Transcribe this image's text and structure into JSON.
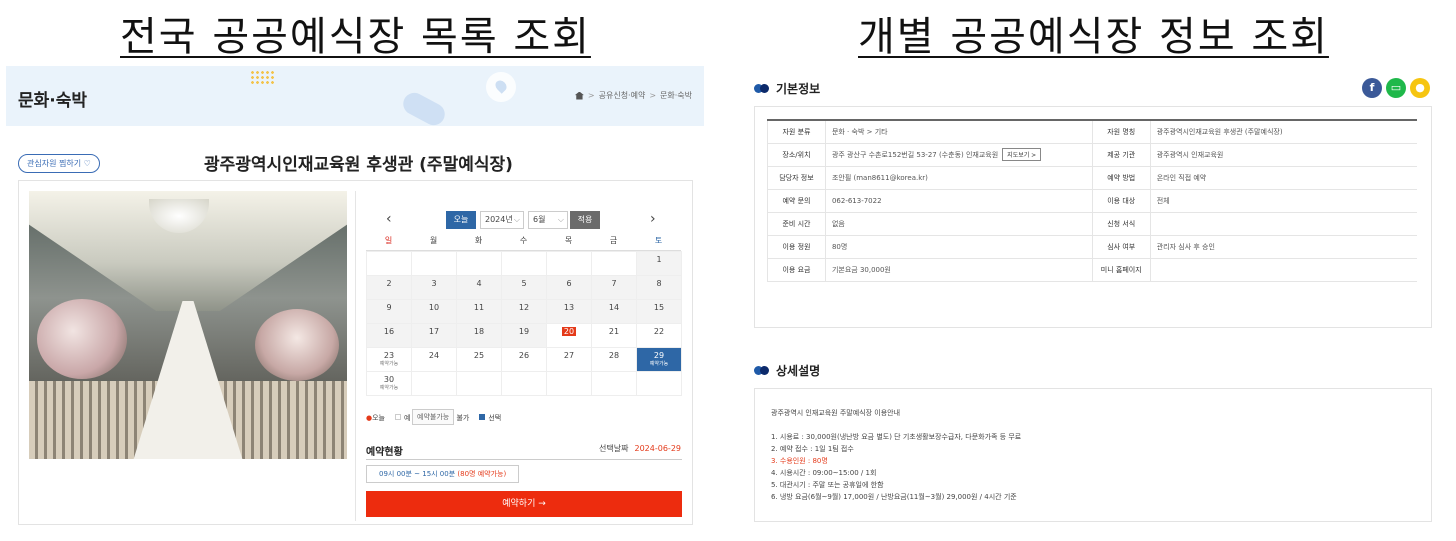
{
  "headings": {
    "left": "전국 공공예식장 목록 조회",
    "right": "개별 공공예식장 정보 조회"
  },
  "list": {
    "category": "문화·숙박",
    "breadcrumb": [
      "공유신청·예약",
      "문화·숙박"
    ],
    "fav_label": "관심자원 찜하기 ♡",
    "venue": "광주광역시인재교육원 후생관 (주말예식장)",
    "calendar": {
      "today_btn": "오늘",
      "year": "2024년",
      "month": "6월",
      "apply_btn": "적용",
      "prev": "‹",
      "next": "›",
      "dow": [
        "일",
        "월",
        "화",
        "수",
        "목",
        "금",
        "토"
      ],
      "dow_colors": [
        "#d9261c",
        "#444",
        "#444",
        "#444",
        "#444",
        "#444",
        "#2e67a6"
      ],
      "weeks": [
        [
          {
            "d": ""
          },
          {
            "d": ""
          },
          {
            "d": ""
          },
          {
            "d": ""
          },
          {
            "d": ""
          },
          {
            "d": ""
          },
          {
            "d": "1",
            "past": true
          }
        ],
        [
          {
            "d": "2",
            "past": true
          },
          {
            "d": "3",
            "past": true
          },
          {
            "d": "4",
            "past": true
          },
          {
            "d": "5",
            "past": true
          },
          {
            "d": "6",
            "past": true
          },
          {
            "d": "7",
            "past": true
          },
          {
            "d": "8",
            "past": true
          }
        ],
        [
          {
            "d": "9",
            "past": true
          },
          {
            "d": "10",
            "past": true
          },
          {
            "d": "11",
            "past": true
          },
          {
            "d": "12",
            "past": true
          },
          {
            "d": "13",
            "past": true
          },
          {
            "d": "14",
            "past": true
          },
          {
            "d": "15",
            "past": true
          }
        ],
        [
          {
            "d": "16",
            "past": true
          },
          {
            "d": "17",
            "past": true
          },
          {
            "d": "18",
            "past": true
          },
          {
            "d": "19",
            "past": true
          },
          {
            "d": "20",
            "today": true
          },
          {
            "d": "21"
          },
          {
            "d": "22"
          }
        ],
        [
          {
            "d": "23",
            "note": "예약가능"
          },
          {
            "d": "24"
          },
          {
            "d": "25"
          },
          {
            "d": "26"
          },
          {
            "d": "27"
          },
          {
            "d": "28"
          },
          {
            "d": "29",
            "note": "예약가능",
            "avail": true
          }
        ],
        [
          {
            "d": "30",
            "note": "예약가능"
          },
          {
            "d": ""
          },
          {
            "d": ""
          },
          {
            "d": ""
          },
          {
            "d": ""
          },
          {
            "d": ""
          },
          {
            "d": ""
          }
        ]
      ],
      "legend": {
        "today": "오늘",
        "reserve": "예",
        "unavail": "불가",
        "selected": "선택"
      },
      "tooltip": "예약불가능",
      "status_title": "예약현황",
      "selected_date_label": "선택날짜",
      "selected_date": "2024-06-29",
      "time_text": "09시 00분 ~ 15시 00분",
      "time_remain": "(80명 예약가능)",
      "reserve_btn": "예약하기 →"
    }
  },
  "detail": {
    "basic_title": "기본정보",
    "social": [
      {
        "icon": "facebook-icon",
        "glyph": "f",
        "color": "#3b5998"
      },
      {
        "icon": "line-icon",
        "glyph": "▭",
        "color": "#1fb84a"
      },
      {
        "icon": "kakao-icon",
        "glyph": "●",
        "color": "#f6c511"
      }
    ],
    "rows": [
      [
        "자원 분류",
        "문화 · 숙박 > 기타",
        "자원 명칭",
        "광주광역시인재교육원 후생관 (주말예식장)"
      ],
      [
        "장소/위치",
        "광주 광산구 수촌로152번길 53-27 (수춘동) 인재교육원",
        "제공 기관",
        "광주광역시 인재교육원"
      ],
      [
        "담당자 정보",
        "조안필 (man8611@korea.kr)",
        "예약 방법",
        "온라인 직접 예약"
      ],
      [
        "예약 문의",
        "062-613-7022",
        "이용 대상",
        "전체"
      ],
      [
        "준비 시간",
        "없음",
        "신청 서식",
        ""
      ],
      [
        "이용 정원",
        "80명",
        "심사 여부",
        "관리자 심사 후 승인"
      ],
      [
        "이용 요금",
        "기본요금 30,000원",
        "미니 홈페이지",
        ""
      ]
    ],
    "map_btn": "지도보기 >",
    "desc_title": "상세설명",
    "desc_lines": [
      {
        "t": "광주광역시 인재교육원 주말예식장 이용안내",
        "red": false
      },
      {
        "t": "",
        "red": false
      },
      {
        "t": "1. 시용료 : 30,000원(냉난방 요금 별도) 단 기초생활보장수급자, 다문화가족 등 무료",
        "red": false
      },
      {
        "t": "2. 예약 접수 : 1일 1팀 접수",
        "red": false
      },
      {
        "t": "3. 수용인원 : 80명",
        "red": true
      },
      {
        "t": "4. 시용시간 : 09:00~15:00 / 1회",
        "red": false
      },
      {
        "t": "5. 대관시기 : 주말 또는 공휴일에 한함",
        "red": false
      },
      {
        "t": "6. 냉방 요금(6월~9월) 17,000원 / 난방요금(11월~3월) 29,000원 / 4시간 기준",
        "red": false
      }
    ]
  }
}
